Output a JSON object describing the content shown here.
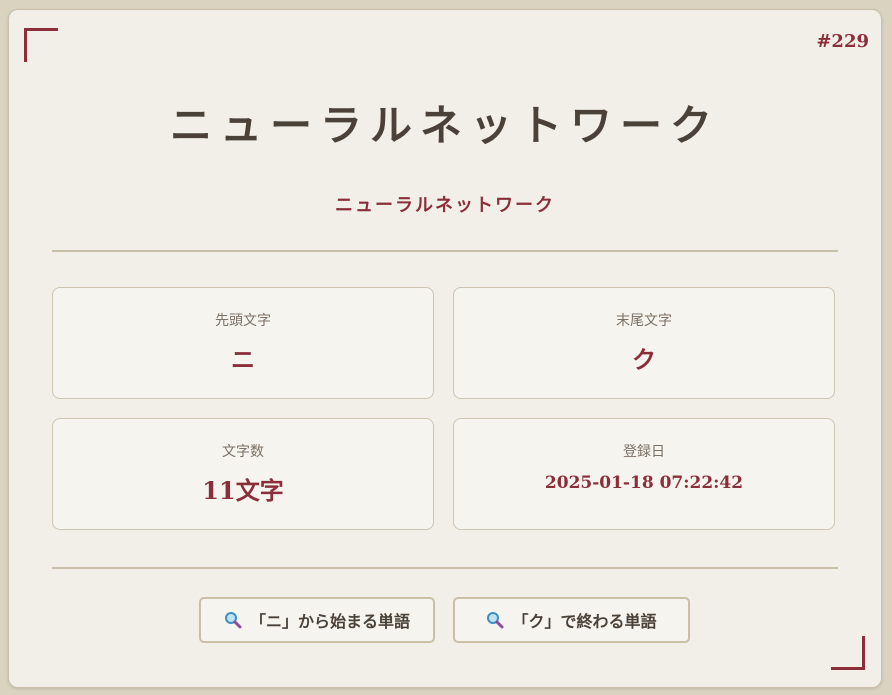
{
  "entry": {
    "number": "#229",
    "word": "ニューラルネットワーク",
    "reading": "ニューラルネットワーク"
  },
  "details": {
    "first_char_label": "先頭文字",
    "first_char": "ニ",
    "last_char_label": "末尾文字",
    "last_char": "ク",
    "length_label": "文字数",
    "length": "11文字",
    "registered_label": "登録日",
    "registered": "2025-01-18 07:22:42"
  },
  "actions": {
    "search_starts_label": "「ニ」から始まる単語",
    "search_ends_label": "「ク」で終わる単語",
    "icon": "magnifier-icon"
  },
  "colors": {
    "accent": "#8b2e3a",
    "background": "#f1efe8",
    "text": "#4a4238"
  }
}
